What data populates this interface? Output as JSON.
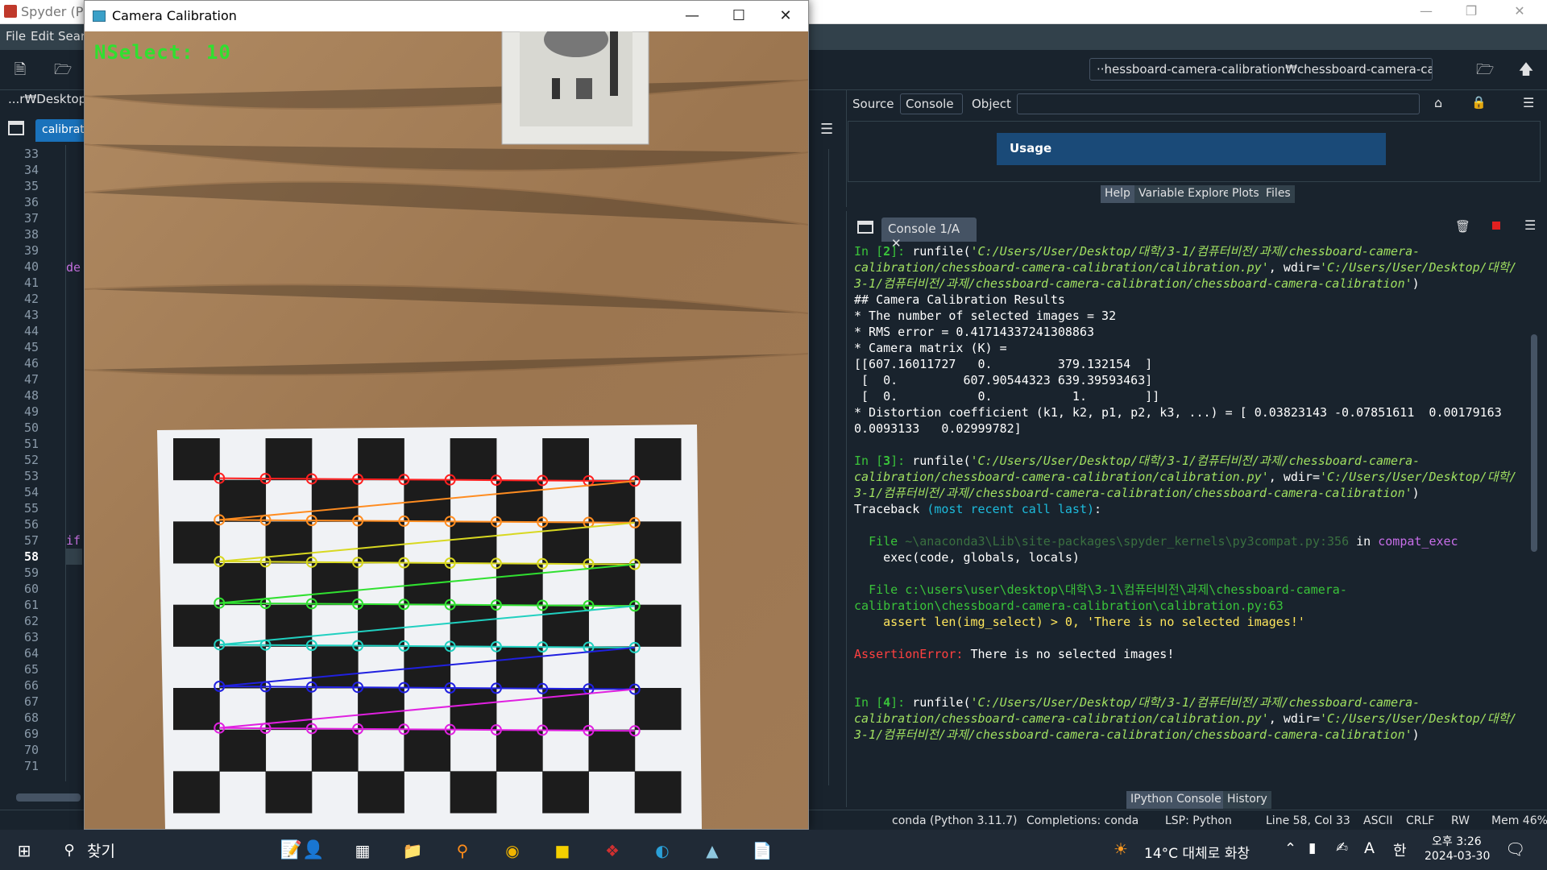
{
  "spyder": {
    "title": "Spyder (Pyt",
    "menu": [
      "File",
      "Edit",
      "Searc"
    ],
    "working_dir": "··hessboard-camera-calibration₩chessboard-camera-calibration",
    "editor_path": "...r₩Desktop₩",
    "editor_tab": "calibratio",
    "line_numbers": [
      "33",
      "34",
      "35",
      "36",
      "37",
      "38",
      "39",
      "40",
      "41",
      "42",
      "43",
      "44",
      "45",
      "46",
      "47",
      "48",
      "49",
      "50",
      "51",
      "52",
      "53",
      "54",
      "55",
      "56",
      "57",
      "58",
      "59",
      "60",
      "61",
      "62",
      "63",
      "64",
      "65",
      "66",
      "67",
      "68",
      "69",
      "70",
      "71"
    ],
    "current_line": "58",
    "code_fragments": {
      "l40": "de",
      "l57": "if"
    },
    "help": {
      "source_label": "Source",
      "source_value": "Console",
      "object_label": "Object",
      "usage_title": "Usage",
      "tabs": [
        "Help",
        "Variable Explorer",
        "Plots",
        "Files"
      ]
    },
    "console": {
      "tab": "Console 1/A",
      "bottom_tabs": [
        "IPython Console",
        "History"
      ]
    },
    "status": {
      "env": "conda (Python 3.11.7)",
      "completions": "Completions: conda",
      "lsp": "LSP: Python",
      "position": "Line 58, Col 33",
      "encoding": "ASCII",
      "eol": "CRLF",
      "rw": "RW",
      "mem": "Mem 46%"
    }
  },
  "camera_window": {
    "title": "Camera Calibration",
    "overlay_text": "NSelect: 10",
    "grid_colors": [
      "#ff2020",
      "#ff8c20",
      "#d8d820",
      "#30e030",
      "#20d0c0",
      "#2020e0",
      "#e020e0"
    ]
  },
  "taskbar": {
    "search_label": "찾기",
    "weather": "14°C  대체로 화창",
    "time": "오후 3:26",
    "date": "2024-03-30",
    "ime1": "A",
    "ime2": "한"
  }
}
